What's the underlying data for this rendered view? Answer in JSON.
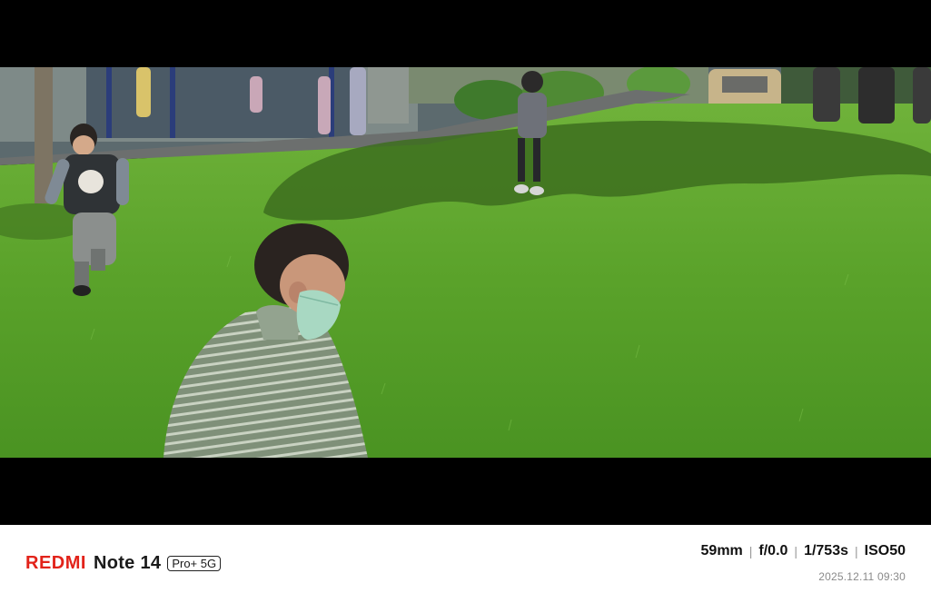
{
  "brand": {
    "name": "REDMI",
    "model": "Note 14",
    "badge": "Pro+ 5G"
  },
  "exif": {
    "focal_length": "59mm",
    "aperture": "f/0.0",
    "shutter": "1/753s",
    "iso": "ISO50",
    "datetime": "2025.12.11 09:30"
  },
  "colors": {
    "brand_red": "#e2231a",
    "grass": "#5aa22a",
    "sky_frame": "#000000"
  }
}
